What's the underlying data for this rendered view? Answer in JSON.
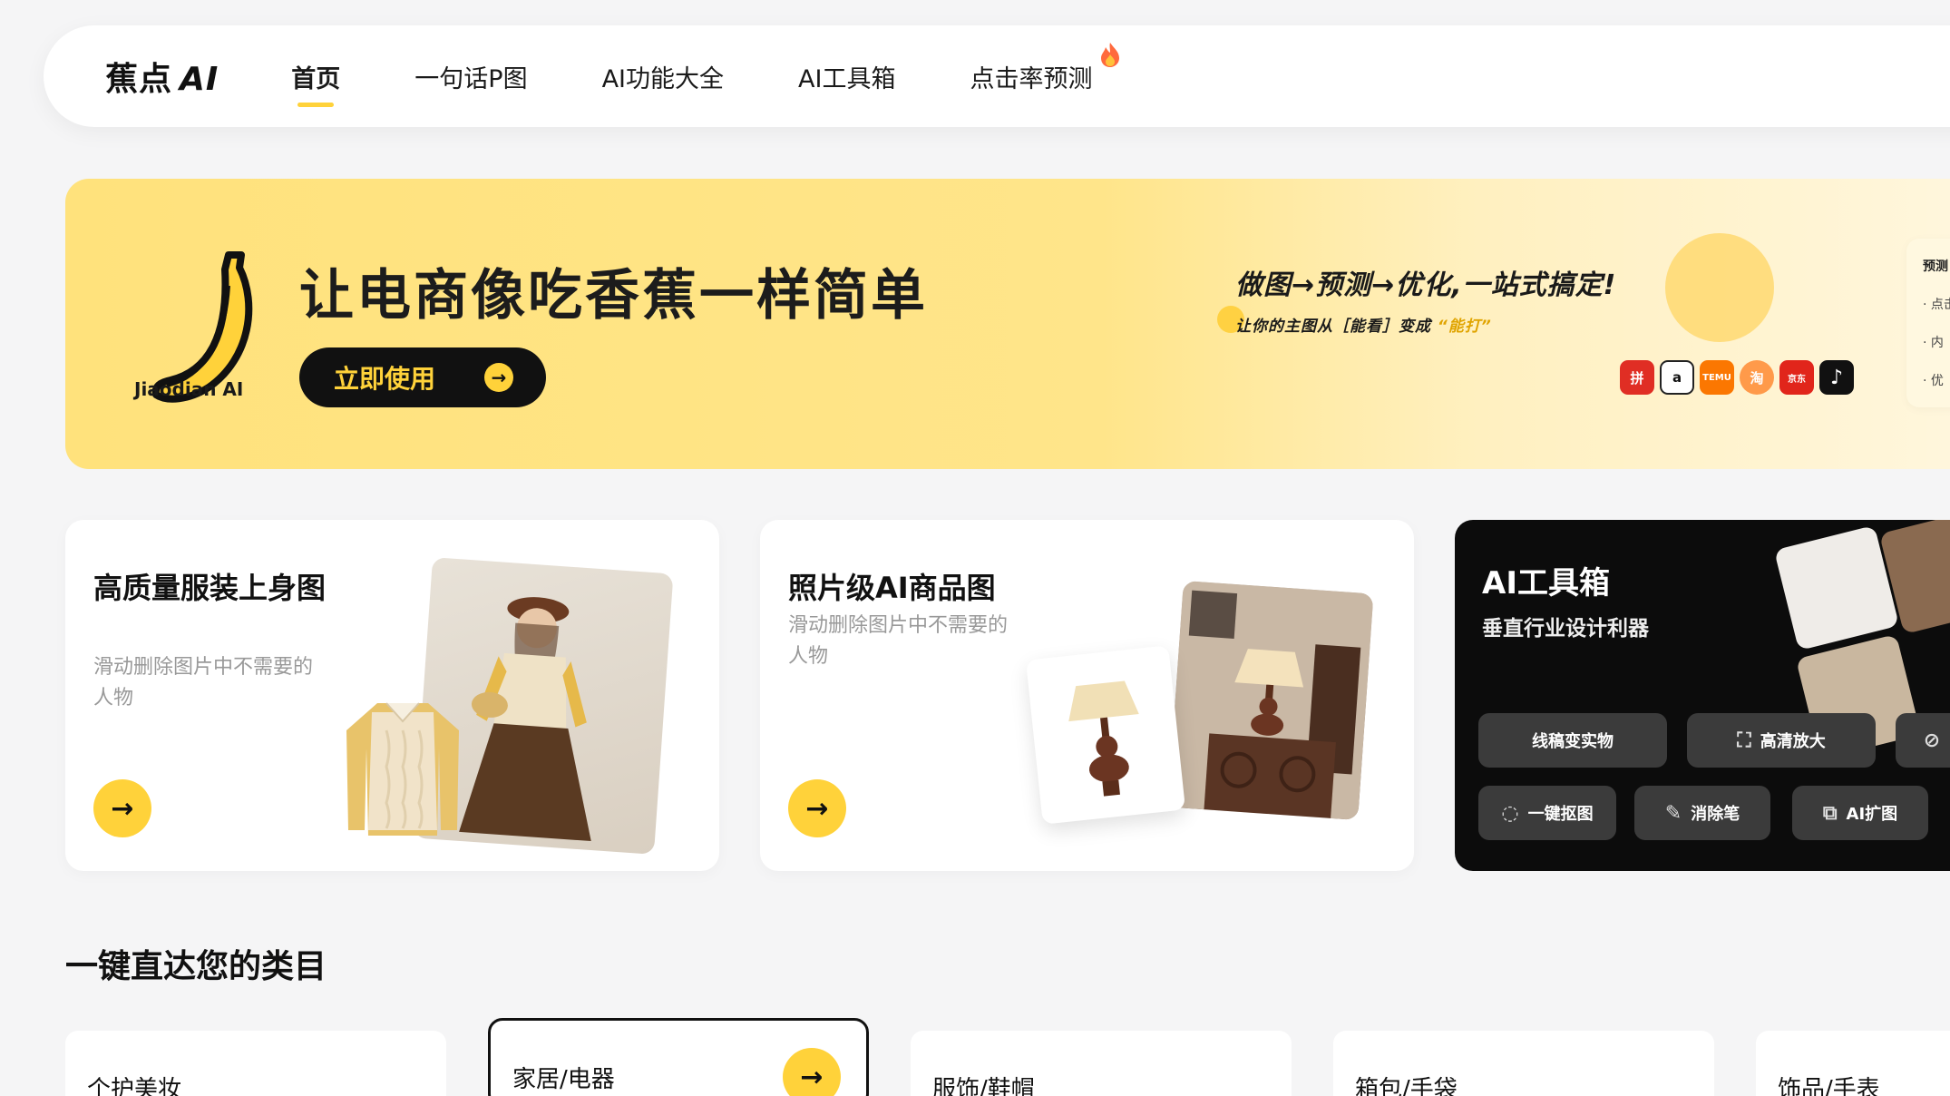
{
  "nav": {
    "logo_main": "蕉点",
    "logo_ai": "AI",
    "items": [
      {
        "label": "首页"
      },
      {
        "label": "一句话P图"
      },
      {
        "label": "AI功能大全"
      },
      {
        "label": "AI工具箱"
      },
      {
        "label": "点击率预测"
      }
    ]
  },
  "hero": {
    "brand_text": "Jiaodian AI",
    "title": "让电商像吃香蕉一样简单",
    "cta_label": "立即使用",
    "slogan": "做图→预测→优化,一站式搞定!",
    "sub_prefix": "让你的主图从［能看］变成",
    "sub_highlight": "“能打”",
    "platforms": [
      "拼",
      "a",
      "TEMU",
      "淘",
      "京东",
      "♪"
    ],
    "side_card": {
      "title": "预测",
      "items": [
        "· 点击",
        "· 内",
        "· 优"
      ]
    }
  },
  "cards": [
    {
      "title": "高质量服装上身图",
      "desc": "滑动删除图片中不需要的人物"
    },
    {
      "title": "照片级AI商品图",
      "desc": "滑动删除图片中不需要的人物"
    }
  ],
  "toolbox": {
    "title": "AI工具箱",
    "subtitle": "垂直行业设计利器",
    "row1": [
      "线稿变实物",
      "高清放大"
    ],
    "row2": [
      "一键抠图",
      "消除笔",
      "AI扩图"
    ]
  },
  "categories": {
    "title": "一键直达您的类目",
    "items": [
      "个护美妆",
      "家居/电器",
      "服饰/鞋帽",
      "箱包/手袋",
      "饰品/手表"
    ]
  },
  "colors": {
    "accent": "#ffd23a",
    "hero_bg": "#ffe27c",
    "dark_card": "#0c0c0c"
  }
}
